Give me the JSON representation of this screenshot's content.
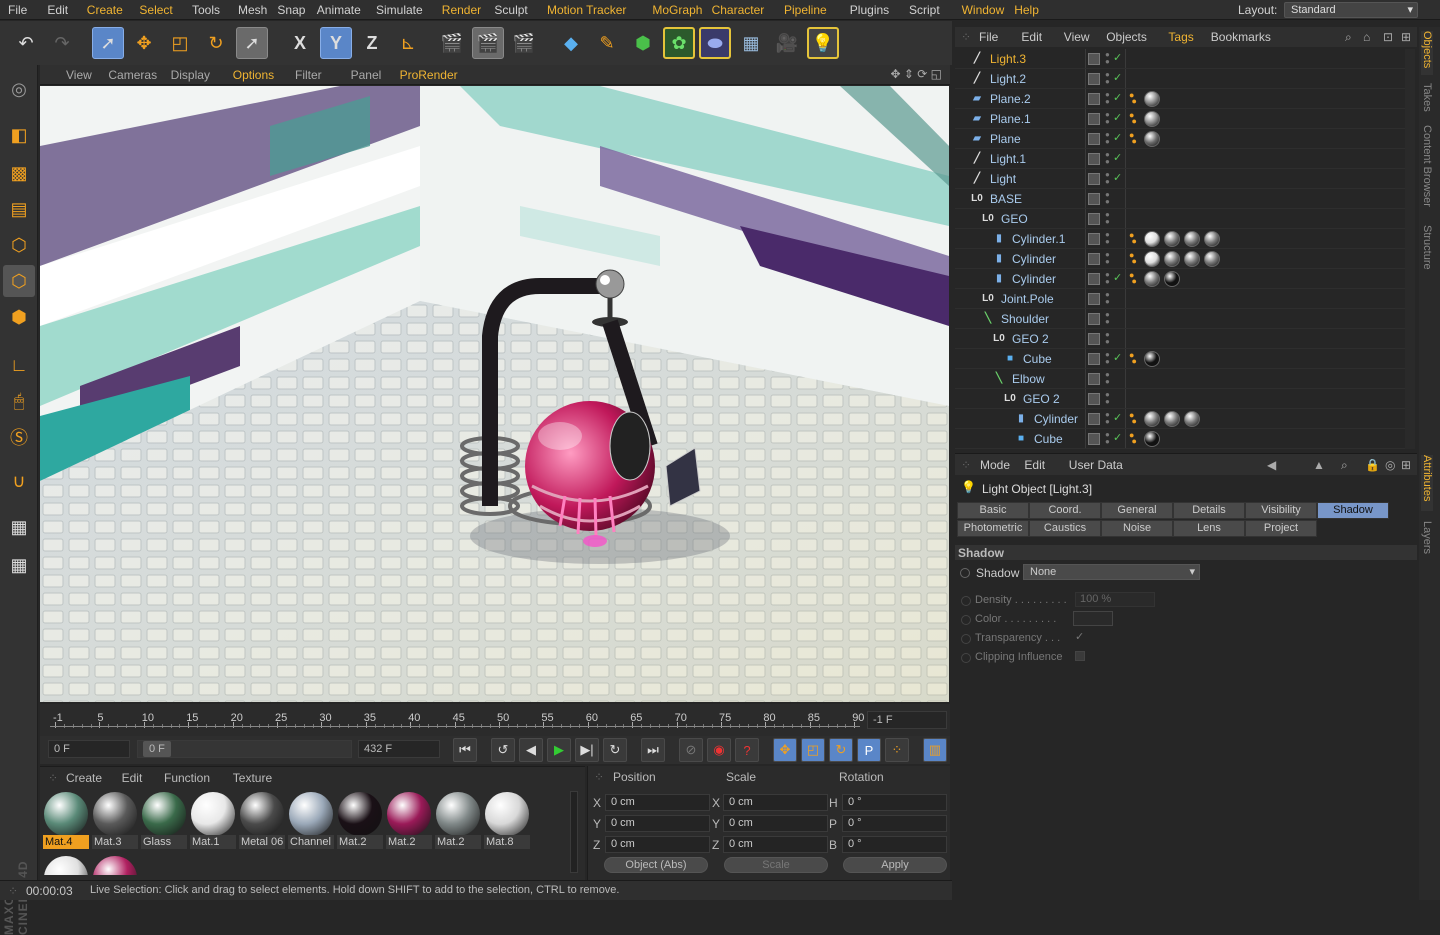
{
  "menubar": {
    "items": [
      "File",
      "Edit",
      "Create",
      "Select",
      "Tools",
      "Mesh",
      "Snap",
      "Animate",
      "Simulate",
      "Render",
      "Sculpt",
      "Motion Tracker",
      "MoGraph",
      "Character",
      "Pipeline",
      "Plugins",
      "Script",
      "Window",
      "Help"
    ],
    "highlighted": [
      "Create",
      "Select",
      "Render",
      "Motion Tracker",
      "MoGraph",
      "Character",
      "Pipeline",
      "Window",
      "Help"
    ],
    "layout_label": "Layout:",
    "layout_value": "Standard"
  },
  "toolbar": {
    "axis_x": "X",
    "axis_y": "Y",
    "axis_z": "Z"
  },
  "viewport": {
    "menu": [
      "View",
      "Cameras",
      "Display",
      "Options",
      "Filter",
      "Panel",
      "ProRender"
    ],
    "highlighted": [
      "Options",
      "ProRender"
    ]
  },
  "timeline": {
    "ticks": [
      "-1",
      "5",
      "10",
      "15",
      "20",
      "25",
      "30",
      "35",
      "40",
      "45",
      "50",
      "55",
      "60",
      "65",
      "70",
      "75",
      "80",
      "85",
      "90"
    ],
    "end_field": "-1 F"
  },
  "transport": {
    "current_frame": "0 F",
    "range_start": "0 F",
    "range_end": "432 F"
  },
  "materials": {
    "menu": [
      "Create",
      "Edit",
      "Function",
      "Texture"
    ],
    "items": [
      {
        "label": "Mat.4",
        "color": "#5a8a78",
        "selected": true
      },
      {
        "label": "Mat.3",
        "color": "#5a5a5a",
        "selected": false
      },
      {
        "label": "Glass",
        "color": "#3a6a4a",
        "selected": false
      },
      {
        "label": "Mat.1",
        "color": "#e8e8e8",
        "selected": false
      },
      {
        "label": "Metal 06",
        "color": "#4a4a4a",
        "selected": false
      },
      {
        "label": "Channel",
        "color": "#9aa8b8",
        "selected": false
      },
      {
        "label": "Mat.2",
        "color": "#1a1016",
        "selected": false
      },
      {
        "label": "Mat.2",
        "color": "#9a1a58",
        "selected": false
      },
      {
        "label": "Mat.2",
        "color": "#808888",
        "selected": false
      },
      {
        "label": "Mat.8",
        "color": "#d8d8d8",
        "selected": false
      }
    ],
    "row2_colors": [
      "#e0e0e0",
      "#b02060"
    ]
  },
  "coordinates": {
    "headers": [
      "Position",
      "Scale",
      "Rotation"
    ],
    "rows": [
      {
        "pl": "X",
        "pv": "0 cm",
        "sl": "X",
        "sv": "0 cm",
        "rl": "H",
        "rv": "0 °"
      },
      {
        "pl": "Y",
        "pv": "0 cm",
        "sl": "Y",
        "sv": "0 cm",
        "rl": "P",
        "rv": "0 °"
      },
      {
        "pl": "Z",
        "pv": "0 cm",
        "sl": "Z",
        "sv": "0 cm",
        "rl": "B",
        "rv": "0 °"
      }
    ],
    "mode": "Object (Abs)",
    "scale_mode": "Scale",
    "apply": "Apply"
  },
  "status": {
    "time": "00:00:03",
    "message": "Live Selection: Click and drag to select elements. Hold down SHIFT to add to the selection, CTRL to remove."
  },
  "objects": {
    "menu": [
      "File",
      "Edit",
      "View",
      "Objects",
      "Tags",
      "Bookmarks"
    ],
    "rows": [
      {
        "name": "Light.3",
        "depth": 0,
        "icon": "light",
        "selected": true,
        "vis": true,
        "tags": []
      },
      {
        "name": "Light.2",
        "depth": 0,
        "icon": "light",
        "selected": false,
        "vis": true,
        "tags": []
      },
      {
        "name": "Plane.2",
        "depth": 0,
        "icon": "plane",
        "selected": false,
        "vis": true,
        "tags": [
          "#8a8a8a"
        ]
      },
      {
        "name": "Plane.1",
        "depth": 0,
        "icon": "plane",
        "selected": false,
        "vis": true,
        "tags": [
          "#8a8a8a"
        ]
      },
      {
        "name": "Plane",
        "depth": 0,
        "icon": "plane",
        "selected": false,
        "vis": true,
        "tags": [
          "#6a6a6a"
        ]
      },
      {
        "name": "Light.1",
        "depth": 0,
        "icon": "light",
        "selected": false,
        "vis": true,
        "tags": []
      },
      {
        "name": "Light",
        "depth": 0,
        "icon": "light",
        "selected": false,
        "vis": true,
        "tags": []
      },
      {
        "name": "BASE",
        "depth": 0,
        "icon": "null",
        "selected": false,
        "vis": false,
        "tags": []
      },
      {
        "name": "GEO",
        "depth": 1,
        "icon": "null",
        "selected": false,
        "vis": false,
        "tags": []
      },
      {
        "name": "Cylinder.1",
        "depth": 2,
        "icon": "cyl",
        "selected": false,
        "vis": false,
        "tags": [
          "#ddd",
          "#777",
          "#777",
          "#777"
        ]
      },
      {
        "name": "Cylinder",
        "depth": 2,
        "icon": "cyl",
        "selected": false,
        "vis": false,
        "tags": [
          "#ddd",
          "#777",
          "#777",
          "#777"
        ]
      },
      {
        "name": "Cylinder",
        "depth": 2,
        "icon": "cyl",
        "selected": false,
        "vis": true,
        "tags": [
          "#777",
          "#111"
        ]
      },
      {
        "name": "Joint.Pole",
        "depth": 1,
        "icon": "null",
        "selected": false,
        "vis": false,
        "tags": []
      },
      {
        "name": "Shoulder",
        "depth": 1,
        "icon": "joint",
        "selected": false,
        "vis": false,
        "tags": []
      },
      {
        "name": "GEO 2",
        "depth": 2,
        "icon": "null",
        "selected": false,
        "vis": false,
        "tags": []
      },
      {
        "name": "Cube",
        "depth": 3,
        "icon": "cube",
        "selected": false,
        "vis": true,
        "tags": [
          "#111"
        ]
      },
      {
        "name": "Elbow",
        "depth": 2,
        "icon": "joint",
        "selected": false,
        "vis": false,
        "tags": []
      },
      {
        "name": "GEO 2",
        "depth": 3,
        "icon": "null",
        "selected": false,
        "vis": false,
        "tags": []
      },
      {
        "name": "Cylinder",
        "depth": 4,
        "icon": "cyl",
        "selected": false,
        "vis": true,
        "tags": [
          "#777",
          "#777",
          "#777"
        ]
      },
      {
        "name": "Cube",
        "depth": 4,
        "icon": "cube",
        "selected": false,
        "vis": true,
        "tags": [
          "#111"
        ]
      }
    ]
  },
  "sidetabs": [
    "Objects",
    "Takes",
    "Content Browser",
    "Structure",
    "Attributes",
    "Layers"
  ],
  "attributes": {
    "menu": [
      "Mode",
      "Edit",
      "User Data"
    ],
    "title": "Light Object [Light.3]",
    "tabs_row1": [
      "Basic",
      "Coord.",
      "General",
      "Details",
      "Visibility",
      "Shadow"
    ],
    "tabs_row2": [
      "Photometric",
      "Caustics",
      "Noise",
      "Lens",
      "Project"
    ],
    "active_tab": "Shadow",
    "section": "Shadow",
    "shadow_label": "Shadow",
    "shadow_value": "None",
    "params": [
      {
        "label": "Density . . . . . . . . .",
        "value": "100 %"
      },
      {
        "label": "Color . . . . . . . . .",
        "value": ""
      },
      {
        "label": "Transparency . . .",
        "value": "✓"
      },
      {
        "label": "Clipping Influence",
        "value": ""
      }
    ]
  }
}
